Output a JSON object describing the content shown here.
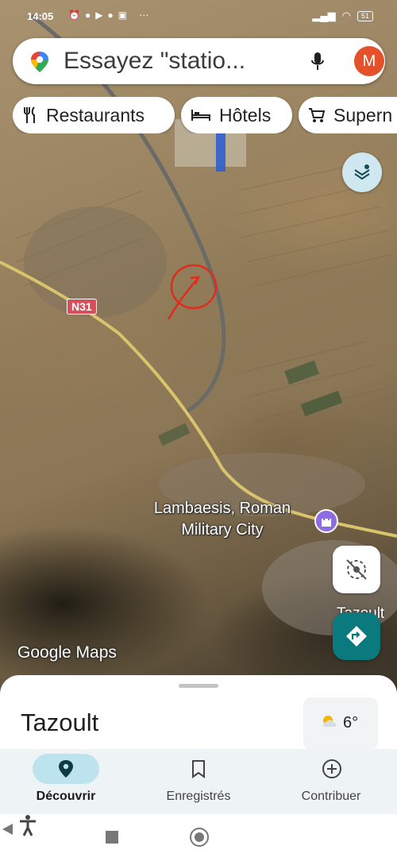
{
  "status_bar": {
    "time": "14:05",
    "battery": "51"
  },
  "search": {
    "placeholder": "Essayez \"statio..."
  },
  "account": {
    "initial": "M"
  },
  "chips": [
    {
      "label": "Restaurants",
      "icon": "fork-knife-icon"
    },
    {
      "label": "Hôtels",
      "icon": "bed-icon"
    },
    {
      "label": "Supern",
      "icon": "cart-icon"
    }
  ],
  "map": {
    "road_shield": "N31",
    "poi_label_line1": "Lambaesis, Roman",
    "poi_label_line2": "Military City",
    "side_label": "Tazoult",
    "watermark": "Google Maps"
  },
  "sheet": {
    "title": "Tazoult",
    "temperature": "6°"
  },
  "nav": [
    {
      "label": "Découvrir",
      "active": true
    },
    {
      "label": "Enregistrés",
      "active": false
    },
    {
      "label": "Contribuer",
      "active": false
    }
  ],
  "colors": {
    "accent": "#0b7a7e",
    "active_pill": "#bde3ee",
    "avatar": "#e5512b",
    "poi": "#8f6be0",
    "road_shield": "#d84f5c"
  }
}
